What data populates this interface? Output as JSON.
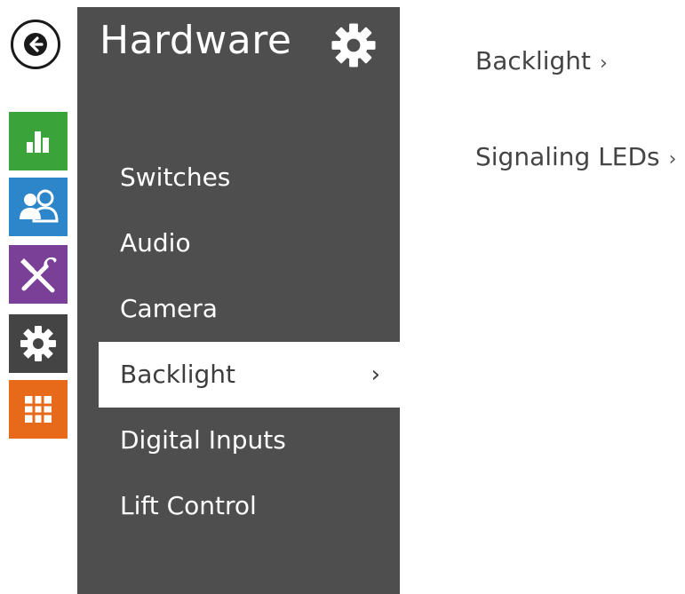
{
  "nav": {
    "back": {
      "icon": "arrow-left-icon"
    },
    "tiles": [
      {
        "id": "status",
        "icon": "bar-chart-icon",
        "color": "#3aa43a"
      },
      {
        "id": "directory",
        "icon": "users-icon",
        "color": "#2c86c9"
      },
      {
        "id": "services",
        "icon": "hammer-wrench-icon",
        "color": "#7a3f97"
      },
      {
        "id": "hardware",
        "icon": "gear-icon",
        "color": "#444444"
      },
      {
        "id": "system",
        "icon": "grid-icon",
        "color": "#e66a19"
      }
    ]
  },
  "panel": {
    "title": "Hardware",
    "title_icon": "gear-icon",
    "background": "#4e4e4e",
    "items": [
      {
        "label": "Switches"
      },
      {
        "label": "Audio"
      },
      {
        "label": "Camera"
      },
      {
        "label": "Backlight",
        "active": true,
        "chevron": "›"
      },
      {
        "label": "Digital Inputs"
      },
      {
        "label": "Lift Control"
      }
    ]
  },
  "content": {
    "links": [
      {
        "label": "Backlight",
        "chevron": "›"
      },
      {
        "label": "Signaling LEDs",
        "chevron": "›"
      }
    ]
  }
}
